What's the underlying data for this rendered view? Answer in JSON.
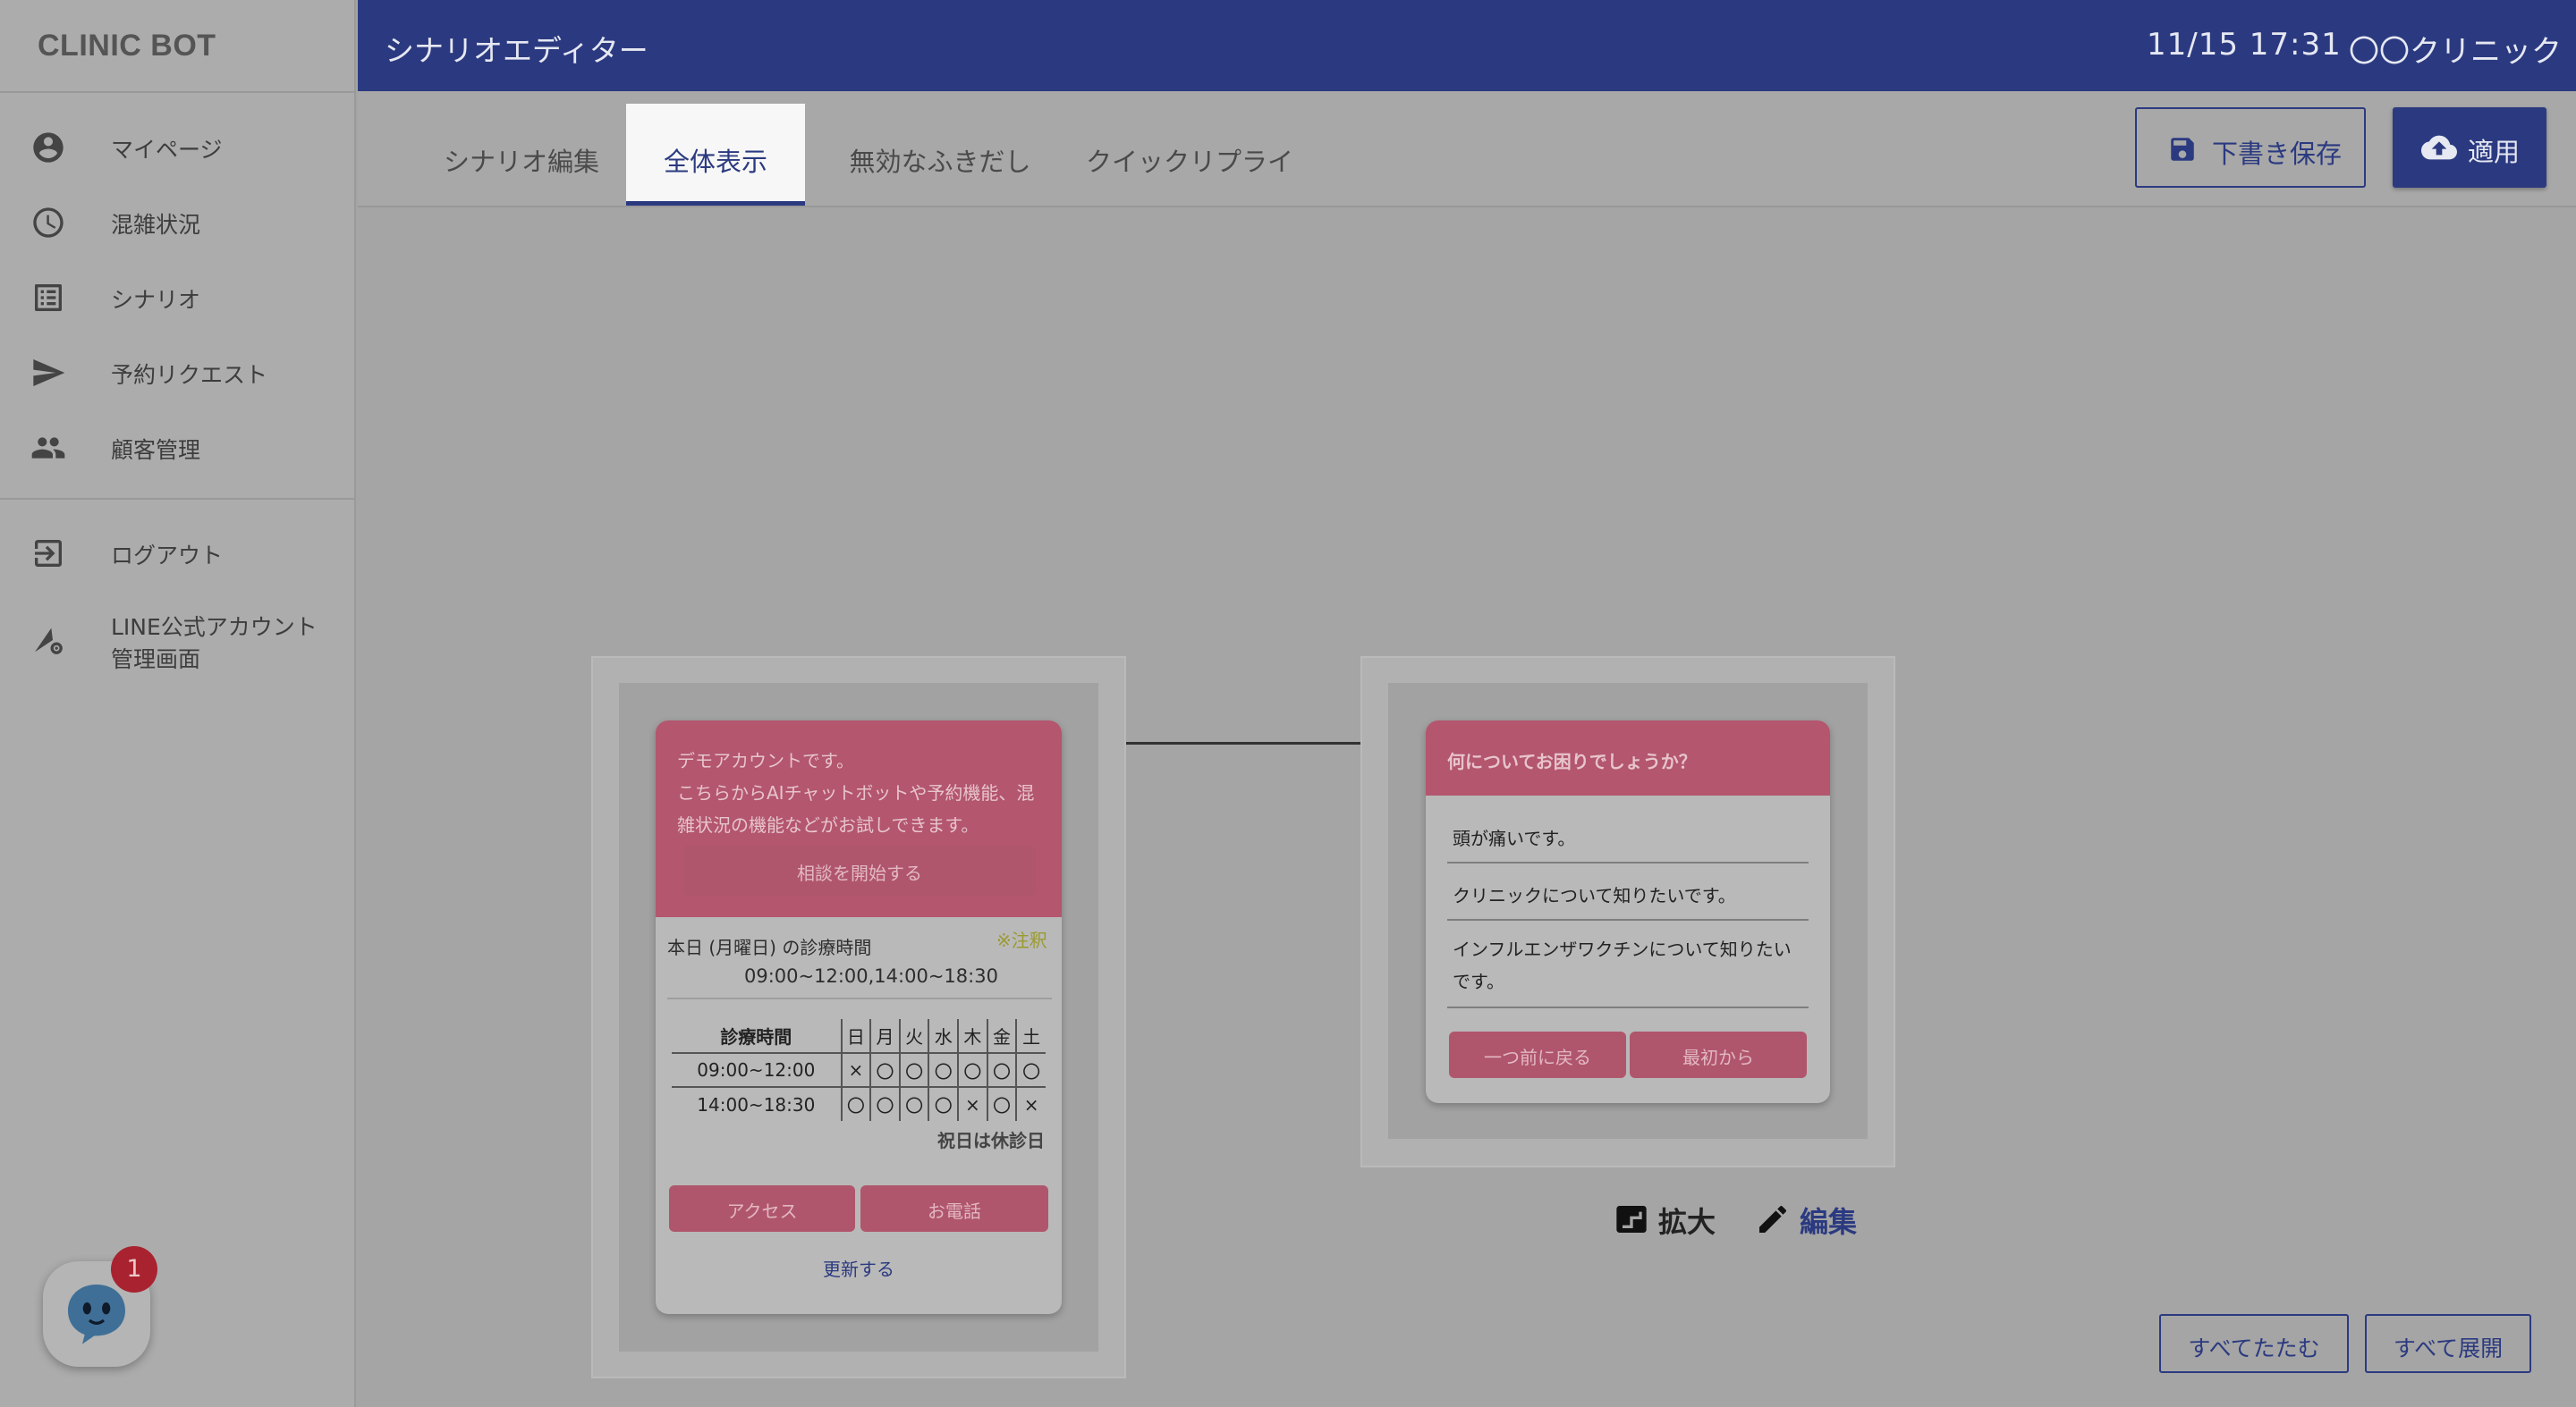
{
  "brand": "CLINIC BOT",
  "sidebar": {
    "items": [
      {
        "label": "マイページ",
        "icon": "account-circle-icon"
      },
      {
        "label": "混雑状況",
        "icon": "clock-icon"
      },
      {
        "label": "シナリオ",
        "icon": "list-icon"
      },
      {
        "label": "予約リクエスト",
        "icon": "send-icon"
      },
      {
        "label": "顧客管理",
        "icon": "people-icon"
      }
    ],
    "logout": {
      "label": "ログアウト",
      "icon": "logout-icon"
    },
    "line_admin": {
      "line1": "LINE公式アカウント",
      "line2": "管理画面",
      "icon": "admin-settings-icon"
    }
  },
  "header": {
    "title": "シナリオエディター",
    "datetime": "11/15 17:31",
    "clinic": "〇〇クリニック"
  },
  "tabs": [
    {
      "label": "シナリオ編集",
      "active": false
    },
    {
      "label": "全体表示",
      "active": true
    },
    {
      "label": "無効なふきだし",
      "active": false
    },
    {
      "label": "クイックリプライ",
      "active": false
    }
  ],
  "toolbar": {
    "draft_label": "下書き保存",
    "apply_label": "適用"
  },
  "node1": {
    "head_lines": [
      "デモアカウントです。",
      "こちらからAIチャットボットや予約機能、混",
      "雑状況の機能などがお試しできます。"
    ],
    "start_button": "相談を開始する",
    "today_label": "本日 (月曜日) の診療時間",
    "note": "※注釈",
    "today_hours": "09:00~12:00,14:00~18:30",
    "table": {
      "header": "診療時間",
      "days": [
        "日",
        "月",
        "火",
        "水",
        "木",
        "金",
        "土"
      ],
      "rows": [
        {
          "time": "09:00~12:00",
          "marks": [
            "×",
            "〇",
            "〇",
            "〇",
            "〇",
            "〇",
            "〇"
          ]
        },
        {
          "time": "14:00~18:30",
          "marks": [
            "〇",
            "〇",
            "〇",
            "〇",
            "×",
            "〇",
            "×"
          ]
        }
      ]
    },
    "holiday_note": "祝日は休診日",
    "access_button": "アクセス",
    "phone_button": "お電話",
    "update_link": "更新する"
  },
  "node2": {
    "question": "何についてお困りでしょうか？",
    "options": [
      "頭が痛いです。",
      "クリニックについて知りたいです。",
      "インフルエンザワクチンについて知りたい",
      "です。"
    ],
    "back_button": "一つ前に戻る",
    "restart_button": "最初から"
  },
  "node_actions": {
    "zoom_label": "拡大",
    "edit_label": "編集"
  },
  "footer": {
    "collapse_all": "すべてたたむ",
    "expand_all": "すべて展開"
  },
  "bot_widget": {
    "badge_count": "1"
  },
  "colors": {
    "primary": "#2b3a80",
    "card_pink": "#b3566e",
    "badge_red": "#a8232f",
    "note_green": "#9a9a2e"
  }
}
